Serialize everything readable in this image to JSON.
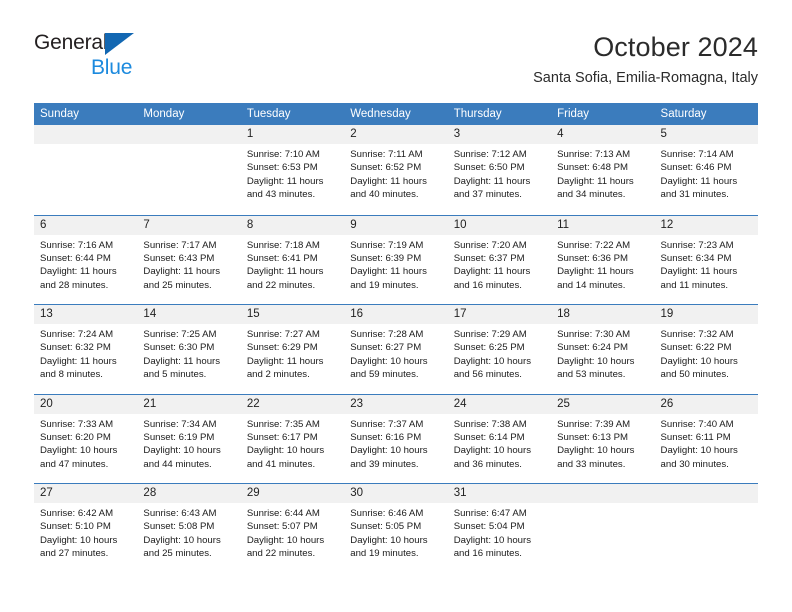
{
  "logo": {
    "word1": "General",
    "word2": "Blue",
    "triangle_color": "#1267b2",
    "word2_color": "#1c8ade"
  },
  "header": {
    "title": "October 2024",
    "subtitle": "Santa Sofia, Emilia-Romagna, Italy"
  },
  "theme": {
    "header_blue": "#3b7cbd",
    "day_strip_gray": "#f1f1f1",
    "text": "#1b1b1b"
  },
  "weekdays": [
    "Sunday",
    "Monday",
    "Tuesday",
    "Wednesday",
    "Thursday",
    "Friday",
    "Saturday"
  ],
  "weeks": [
    [
      {
        "empty": true,
        "day": ""
      },
      {
        "empty": true,
        "day": ""
      },
      {
        "day": "1",
        "lines": [
          "Sunrise: 7:10 AM",
          "Sunset: 6:53 PM",
          "Daylight: 11 hours",
          "and 43 minutes."
        ]
      },
      {
        "day": "2",
        "lines": [
          "Sunrise: 7:11 AM",
          "Sunset: 6:52 PM",
          "Daylight: 11 hours",
          "and 40 minutes."
        ]
      },
      {
        "day": "3",
        "lines": [
          "Sunrise: 7:12 AM",
          "Sunset: 6:50 PM",
          "Daylight: 11 hours",
          "and 37 minutes."
        ]
      },
      {
        "day": "4",
        "lines": [
          "Sunrise: 7:13 AM",
          "Sunset: 6:48 PM",
          "Daylight: 11 hours",
          "and 34 minutes."
        ]
      },
      {
        "day": "5",
        "lines": [
          "Sunrise: 7:14 AM",
          "Sunset: 6:46 PM",
          "Daylight: 11 hours",
          "and 31 minutes."
        ]
      }
    ],
    [
      {
        "day": "6",
        "lines": [
          "Sunrise: 7:16 AM",
          "Sunset: 6:44 PM",
          "Daylight: 11 hours",
          "and 28 minutes."
        ]
      },
      {
        "day": "7",
        "lines": [
          "Sunrise: 7:17 AM",
          "Sunset: 6:43 PM",
          "Daylight: 11 hours",
          "and 25 minutes."
        ]
      },
      {
        "day": "8",
        "lines": [
          "Sunrise: 7:18 AM",
          "Sunset: 6:41 PM",
          "Daylight: 11 hours",
          "and 22 minutes."
        ]
      },
      {
        "day": "9",
        "lines": [
          "Sunrise: 7:19 AM",
          "Sunset: 6:39 PM",
          "Daylight: 11 hours",
          "and 19 minutes."
        ]
      },
      {
        "day": "10",
        "lines": [
          "Sunrise: 7:20 AM",
          "Sunset: 6:37 PM",
          "Daylight: 11 hours",
          "and 16 minutes."
        ]
      },
      {
        "day": "11",
        "lines": [
          "Sunrise: 7:22 AM",
          "Sunset: 6:36 PM",
          "Daylight: 11 hours",
          "and 14 minutes."
        ]
      },
      {
        "day": "12",
        "lines": [
          "Sunrise: 7:23 AM",
          "Sunset: 6:34 PM",
          "Daylight: 11 hours",
          "and 11 minutes."
        ]
      }
    ],
    [
      {
        "day": "13",
        "lines": [
          "Sunrise: 7:24 AM",
          "Sunset: 6:32 PM",
          "Daylight: 11 hours",
          "and 8 minutes."
        ]
      },
      {
        "day": "14",
        "lines": [
          "Sunrise: 7:25 AM",
          "Sunset: 6:30 PM",
          "Daylight: 11 hours",
          "and 5 minutes."
        ]
      },
      {
        "day": "15",
        "lines": [
          "Sunrise: 7:27 AM",
          "Sunset: 6:29 PM",
          "Daylight: 11 hours",
          "and 2 minutes."
        ]
      },
      {
        "day": "16",
        "lines": [
          "Sunrise: 7:28 AM",
          "Sunset: 6:27 PM",
          "Daylight: 10 hours",
          "and 59 minutes."
        ]
      },
      {
        "day": "17",
        "lines": [
          "Sunrise: 7:29 AM",
          "Sunset: 6:25 PM",
          "Daylight: 10 hours",
          "and 56 minutes."
        ]
      },
      {
        "day": "18",
        "lines": [
          "Sunrise: 7:30 AM",
          "Sunset: 6:24 PM",
          "Daylight: 10 hours",
          "and 53 minutes."
        ]
      },
      {
        "day": "19",
        "lines": [
          "Sunrise: 7:32 AM",
          "Sunset: 6:22 PM",
          "Daylight: 10 hours",
          "and 50 minutes."
        ]
      }
    ],
    [
      {
        "day": "20",
        "lines": [
          "Sunrise: 7:33 AM",
          "Sunset: 6:20 PM",
          "Daylight: 10 hours",
          "and 47 minutes."
        ]
      },
      {
        "day": "21",
        "lines": [
          "Sunrise: 7:34 AM",
          "Sunset: 6:19 PM",
          "Daylight: 10 hours",
          "and 44 minutes."
        ]
      },
      {
        "day": "22",
        "lines": [
          "Sunrise: 7:35 AM",
          "Sunset: 6:17 PM",
          "Daylight: 10 hours",
          "and 41 minutes."
        ]
      },
      {
        "day": "23",
        "lines": [
          "Sunrise: 7:37 AM",
          "Sunset: 6:16 PM",
          "Daylight: 10 hours",
          "and 39 minutes."
        ]
      },
      {
        "day": "24",
        "lines": [
          "Sunrise: 7:38 AM",
          "Sunset: 6:14 PM",
          "Daylight: 10 hours",
          "and 36 minutes."
        ]
      },
      {
        "day": "25",
        "lines": [
          "Sunrise: 7:39 AM",
          "Sunset: 6:13 PM",
          "Daylight: 10 hours",
          "and 33 minutes."
        ]
      },
      {
        "day": "26",
        "lines": [
          "Sunrise: 7:40 AM",
          "Sunset: 6:11 PM",
          "Daylight: 10 hours",
          "and 30 minutes."
        ]
      }
    ],
    [
      {
        "day": "27",
        "lines": [
          "Sunrise: 6:42 AM",
          "Sunset: 5:10 PM",
          "Daylight: 10 hours",
          "and 27 minutes."
        ]
      },
      {
        "day": "28",
        "lines": [
          "Sunrise: 6:43 AM",
          "Sunset: 5:08 PM",
          "Daylight: 10 hours",
          "and 25 minutes."
        ]
      },
      {
        "day": "29",
        "lines": [
          "Sunrise: 6:44 AM",
          "Sunset: 5:07 PM",
          "Daylight: 10 hours",
          "and 22 minutes."
        ]
      },
      {
        "day": "30",
        "lines": [
          "Sunrise: 6:46 AM",
          "Sunset: 5:05 PM",
          "Daylight: 10 hours",
          "and 19 minutes."
        ]
      },
      {
        "day": "31",
        "lines": [
          "Sunrise: 6:47 AM",
          "Sunset: 5:04 PM",
          "Daylight: 10 hours",
          "and 16 minutes."
        ]
      },
      {
        "empty": true,
        "day": ""
      },
      {
        "empty": true,
        "day": ""
      }
    ]
  ]
}
